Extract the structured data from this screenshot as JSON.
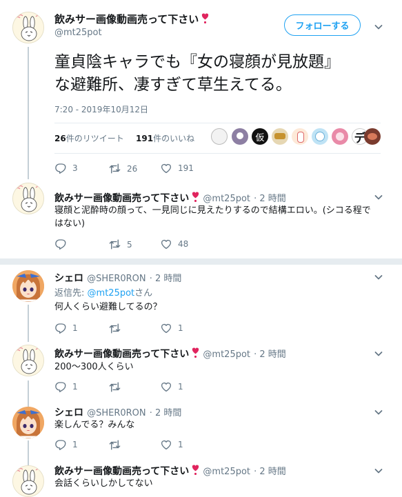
{
  "main_tweet": {
    "display_name": "飲みサー画像動画売って下さい",
    "handle": "@mt25pot",
    "follow_label": "フォローする",
    "text_line1": "童貞陰キャラでも『女の寝顔が見放題』",
    "text_line2": "な避難所、凄すぎて草生えてる。",
    "timestamp": "7:20 - 2019年10月12日",
    "retweet_count": "26",
    "retweet_label": "件のリツイート",
    "like_count": "191",
    "like_label": "件のいいね",
    "action_replies": "3",
    "action_retweets": "26",
    "action_likes": "191",
    "liker_last_glyph": "デ",
    "liker_kanji": "仮"
  },
  "replies": [
    {
      "display_name": "飲みサー画像動画売って下さい",
      "handle": "@mt25pot",
      "time": "· 2 時間",
      "text_line1": "寝顔と泥酔時の顔って、一見同じに見えたりするので結構エロい。(シコる程で",
      "text_line2": "はない)",
      "replies": "",
      "retweets": "5",
      "likes": "48"
    },
    {
      "display_name": "シェロ",
      "handle": "@SHER0RON",
      "time": "· 2 時間",
      "reply_to_prefix": "返信先:",
      "reply_to_handle": "@mt25pot",
      "reply_to_suffix": "さん",
      "text_line1": "何人くらい避難してるの？",
      "replies": "1",
      "retweets": "",
      "likes": "1"
    },
    {
      "display_name": "飲みサー画像動画売って下さい",
      "handle": "@mt25pot",
      "time": "· 2 時間",
      "text_line1": "200〜300人くらい",
      "replies": "1",
      "retweets": "",
      "likes": "1"
    },
    {
      "display_name": "シェロ",
      "handle": "@SHER0RON",
      "time": "· 2 時間",
      "text_line1": "楽しんでる？みんな",
      "replies": "1",
      "retweets": "",
      "likes": "1"
    },
    {
      "display_name": "飲みサー画像動画売って下さい",
      "handle": "@mt25pot",
      "time": "· 2 時間",
      "text_line1": "会話くらいしかしてない"
    }
  ],
  "colors": {
    "accent": "#1da1f2",
    "muted": "#657786",
    "heart_badge": "#e0245e"
  }
}
